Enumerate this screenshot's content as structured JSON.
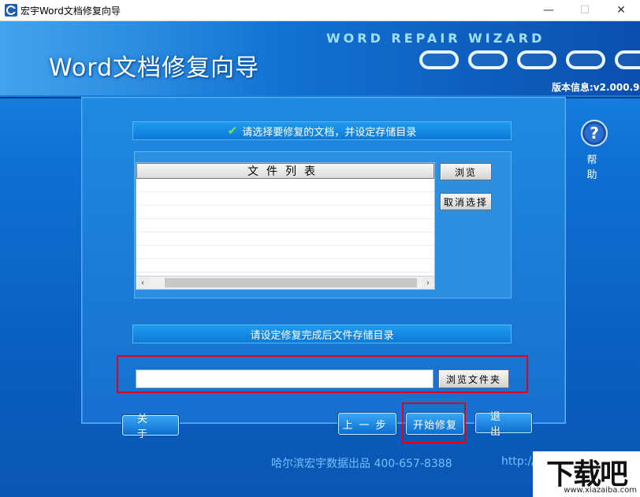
{
  "window": {
    "title": "宏宇Word文档修复向导",
    "minimize_glyph": "—",
    "maximize_glyph": "☐",
    "close_glyph": "✕"
  },
  "banner": {
    "app_title": "Word文档修复向导",
    "brand": "WORD REPAIR WIZARD",
    "version": "版本信息:v2.000.9"
  },
  "help": {
    "label": "帮助",
    "icon": "help-question-icon"
  },
  "file_section": {
    "heading": "请选择要修复的文档，并设定存储目录",
    "check_icon": "✔",
    "list_header": "文件列表",
    "files": [],
    "browse_label": "浏览",
    "cancel_select_label": "取消选择",
    "scroll_left": "‹",
    "scroll_right": "›"
  },
  "output_section": {
    "heading": "请设定修复完成后文件存储目录",
    "path_value": "",
    "browse_folder_label": "浏览文件夹"
  },
  "buttons": {
    "about": "关于",
    "prev": "上一步",
    "start_repair": "开始修复",
    "exit": "退出"
  },
  "footer": {
    "publisher": "哈尔滨宏宇数据出品 400-657-8388",
    "url_partial": "http://"
  },
  "watermark": {
    "main": "下载吧",
    "sub": "www.xiazaiba.com"
  },
  "colors": {
    "highlight": "#e3001b",
    "accent_blue": "#0f70d3"
  }
}
